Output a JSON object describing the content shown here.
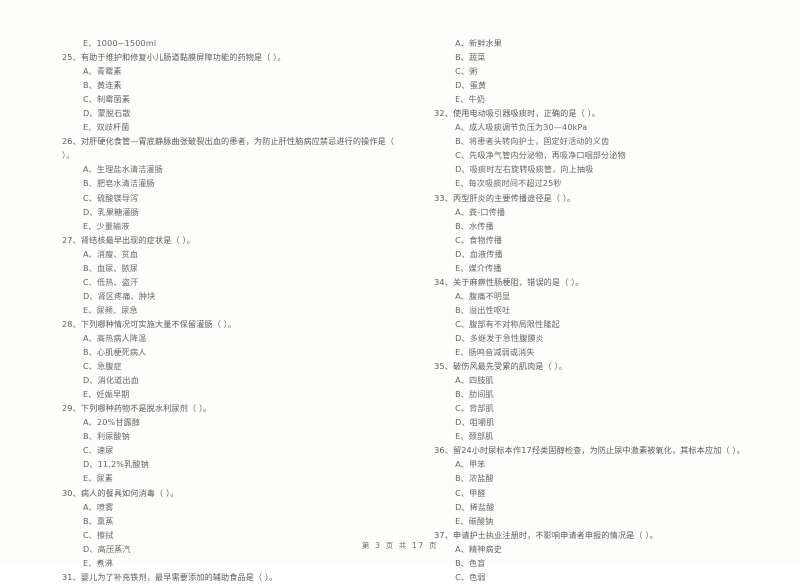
{
  "document": {
    "type": "scanned-exam-paper",
    "footer": "第 3 页 共 17 页"
  },
  "left_column": {
    "lines": [
      {
        "kind": "option",
        "text": "E、1000~1500ml"
      },
      {
        "kind": "question",
        "text": "25、有助于维护和修复小儿肠道黏膜屏障功能的药物是（    ）。"
      },
      {
        "kind": "option",
        "text": "A、青霉素"
      },
      {
        "kind": "option",
        "text": "B、黄连素"
      },
      {
        "kind": "option",
        "text": "C、制霉菌素"
      },
      {
        "kind": "option",
        "text": "D、蒙脱石散"
      },
      {
        "kind": "option",
        "text": "E、双歧杆菌"
      },
      {
        "kind": "question",
        "text": "26、对肝硬化食管—胃底静脉曲张破裂出血的患者，为防止肝性脑病应禁忌进行的操作是（"
      },
      {
        "kind": "question-cont",
        "text": "）。"
      },
      {
        "kind": "option",
        "text": "A、生理盐水清洁灌肠"
      },
      {
        "kind": "option",
        "text": "B、肥皂水清洁灌肠"
      },
      {
        "kind": "option",
        "text": "C、硫酸镁导泻"
      },
      {
        "kind": "option",
        "text": "D、乳果糖灌肠"
      },
      {
        "kind": "option",
        "text": "E、少量输液"
      },
      {
        "kind": "question",
        "text": "27、肾结核最早出现的症状是（    ）。"
      },
      {
        "kind": "option",
        "text": "A、消瘦、贫血"
      },
      {
        "kind": "option",
        "text": "B、血尿、脓尿"
      },
      {
        "kind": "option",
        "text": "C、低热、盗汗"
      },
      {
        "kind": "option",
        "text": "D、肾区疼痛、肿块"
      },
      {
        "kind": "option",
        "text": "E、尿频、尿急"
      },
      {
        "kind": "question",
        "text": "28、下列哪种情况可实施大量不保留灌肠（    ）。"
      },
      {
        "kind": "option",
        "text": "A、高热病人降温"
      },
      {
        "kind": "option",
        "text": "B、心肌梗死病人"
      },
      {
        "kind": "option",
        "text": "C、急腹症"
      },
      {
        "kind": "option",
        "text": "D、消化道出血"
      },
      {
        "kind": "option",
        "text": "E、妊娠早期"
      },
      {
        "kind": "question",
        "text": "29、下列哪种药物不是脱水利尿剂（    ）。"
      },
      {
        "kind": "option",
        "text": "A、20%甘露醇"
      },
      {
        "kind": "option",
        "text": "B、利尿酸钠"
      },
      {
        "kind": "option",
        "text": "C、速尿"
      },
      {
        "kind": "option",
        "text": "D、11.2%乳酸钠"
      },
      {
        "kind": "option",
        "text": "E、尿素"
      },
      {
        "kind": "question",
        "text": "30、病人的餐具如何消毒（    ）。"
      },
      {
        "kind": "option",
        "text": "A、喷雾"
      },
      {
        "kind": "option",
        "text": "B、熏蒸"
      },
      {
        "kind": "option",
        "text": "C、擦拭"
      },
      {
        "kind": "option",
        "text": "D、高压蒸汽"
      },
      {
        "kind": "option",
        "text": "E、煮沸"
      },
      {
        "kind": "question",
        "text": "31、婴儿为了补充铁剂，最早需要添加的辅助食品是（    ）。"
      }
    ]
  },
  "right_column": {
    "lines": [
      {
        "kind": "option",
        "text": "A、新鲜水果"
      },
      {
        "kind": "option",
        "text": "B、蔬菜"
      },
      {
        "kind": "option",
        "text": "C、粥"
      },
      {
        "kind": "option",
        "text": "D、蛋黄"
      },
      {
        "kind": "option",
        "text": "E、牛奶"
      },
      {
        "kind": "question",
        "text": "32、使用电动吸引器吸痰时，正确的是（    ）。"
      },
      {
        "kind": "option",
        "text": "A、成人吸痰调节负压为30—40kPa"
      },
      {
        "kind": "option",
        "text": "B、将患者头转向护士，固定好活动的义齿"
      },
      {
        "kind": "option",
        "text": "C、先吸净气管内分泌物，再吸净口咽部分泌物"
      },
      {
        "kind": "option",
        "text": "D、吸痰时左右旋转吸痰管，向上抽吸"
      },
      {
        "kind": "option",
        "text": "E、每次吸痰时间不超过25秒"
      },
      {
        "kind": "question",
        "text": "33、丙型肝炎的主要传播途径是（    ）。"
      },
      {
        "kind": "option",
        "text": "A、粪-口传播"
      },
      {
        "kind": "option",
        "text": "B、水传播"
      },
      {
        "kind": "option",
        "text": "C、食物传播"
      },
      {
        "kind": "option",
        "text": "D、血液传播"
      },
      {
        "kind": "option",
        "text": "E、媒介传播"
      },
      {
        "kind": "question",
        "text": "34、关于麻痹性肠梗阻，错误的是（    ）。"
      },
      {
        "kind": "option",
        "text": "A、腹痛不明显"
      },
      {
        "kind": "option",
        "text": "B、溢出性呕吐"
      },
      {
        "kind": "option",
        "text": "C、腹部有不对称局限性隆起"
      },
      {
        "kind": "option",
        "text": "D、多继发于急性腹膜炎"
      },
      {
        "kind": "option",
        "text": "E、肠鸣音减弱或消失"
      },
      {
        "kind": "question",
        "text": "35、破伤风最先受累的肌肉是（    ）。"
      },
      {
        "kind": "option",
        "text": "A、四肢肌"
      },
      {
        "kind": "option",
        "text": "B、肋间肌"
      },
      {
        "kind": "option",
        "text": "C、背部肌"
      },
      {
        "kind": "option",
        "text": "D、咀嚼肌"
      },
      {
        "kind": "option",
        "text": "E、颈部肌"
      },
      {
        "kind": "question",
        "text": "36、留24小时尿标本作17羟类固醇检查，为防止尿中激素被氧化，其标本应加（    ）。"
      },
      {
        "kind": "option",
        "text": "A、甲苯"
      },
      {
        "kind": "option",
        "text": "B、浓盐酸"
      },
      {
        "kind": "option",
        "text": "C、甲醛"
      },
      {
        "kind": "option",
        "text": "D、稀盐酸"
      },
      {
        "kind": "option",
        "text": "E、碳酸钠"
      },
      {
        "kind": "question",
        "text": "37、申请护士执业注册时，不影响申请者申报的情况是（    ）。"
      },
      {
        "kind": "option",
        "text": "A、精神病史"
      },
      {
        "kind": "option",
        "text": "B、色盲"
      },
      {
        "kind": "option",
        "text": "C、色弱"
      }
    ]
  }
}
